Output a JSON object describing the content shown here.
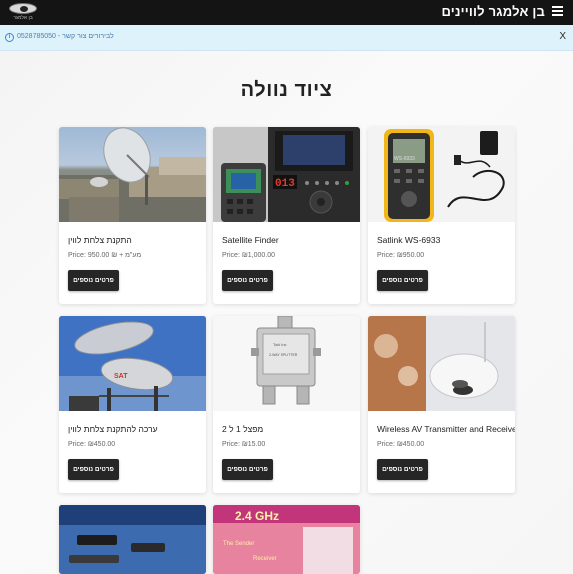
{
  "header": {
    "brand": "בן אלמגר לוויינים",
    "logo_text": "בן אלמגר"
  },
  "notice": {
    "text": "לבירורים צור קשר - 0528785050",
    "close": "X"
  },
  "page_title": "ציוד נוולה",
  "products": [
    {
      "title": "התקנת צלחת לווין",
      "price": "Price: 950.00 ₪ + מע\"מ",
      "button": "פרטים נוספים",
      "image_icon": "satellite-dish-roof-photo"
    },
    {
      "title": "Satellite Finder",
      "price": "Price: ₪1,000.00",
      "button": "פרטים נוספים",
      "image_icon": "satellite-finder-device-photo"
    },
    {
      "title": "Satlink WS-6933",
      "price": "Price: ₪950.00",
      "button": "פרטים נוספים",
      "image_icon": "satlink-meter-photo"
    },
    {
      "title": "ערכה להתקנת צלחת לווין",
      "price": "Price: ₪450.00",
      "button": "פרטים נוספים",
      "image_icon": "satellite-dish-kit-photo"
    },
    {
      "title": "מפצל 1 ל 2",
      "price": "Price: ₪15.00",
      "button": "פרטים נוספים",
      "image_icon": "splitter-photo"
    },
    {
      "title": "Wireless AV Transmitter and Receiver",
      "price": "Price: ₪450.00",
      "button": "פרטים נוספים",
      "image_icon": "wireless-av-photo"
    },
    {
      "image_icon": "product-photo"
    },
    {
      "image_icon": "product-photo"
    }
  ],
  "colors": {
    "topbar": "#141414",
    "notice_bg": "#def2fb",
    "notice_text": "#4a7fae",
    "button": "#262626"
  }
}
